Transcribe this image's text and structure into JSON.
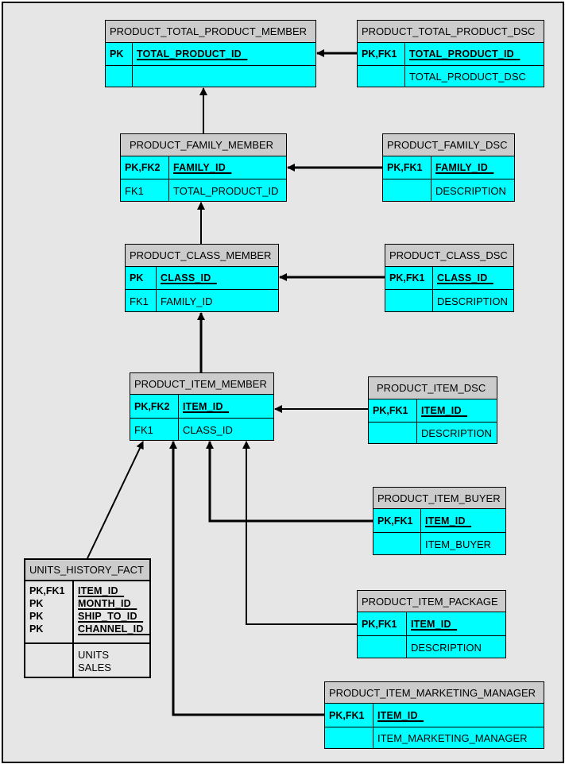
{
  "diagram": {
    "type": "entity-relationship",
    "colors": {
      "background": "#e6e6e6",
      "table_header": "#cccccc",
      "table_body": "#00ffff",
      "fact_body": "#e6e6e6",
      "lines": "#000000"
    }
  },
  "tables": {
    "total_product_member": {
      "name": "PRODUCT_TOTAL_PRODUCT_MEMBER",
      "key_rows": [
        {
          "key": "PK",
          "column": "TOTAL_PRODUCT_ID"
        }
      ],
      "attr_rows": [
        {
          "key": "",
          "column": ""
        }
      ]
    },
    "total_product_dsc": {
      "name": "PRODUCT_TOTAL_PRODUCT_DSC",
      "key_rows": [
        {
          "key": "PK,FK1",
          "column": "TOTAL_PRODUCT_ID"
        }
      ],
      "attr_rows": [
        {
          "key": "",
          "column": "TOTAL_PRODUCT_DSC"
        }
      ]
    },
    "family_member": {
      "name": "PRODUCT_FAMILY_MEMBER",
      "key_rows": [
        {
          "key": "PK,FK2",
          "column": "FAMILY_ID"
        }
      ],
      "attr_rows": [
        {
          "key": "FK1",
          "column": "TOTAL_PRODUCT_ID"
        }
      ]
    },
    "family_dsc": {
      "name": "PRODUCT_FAMILY_DSC",
      "key_rows": [
        {
          "key": "PK,FK1",
          "column": "FAMILY_ID"
        }
      ],
      "attr_rows": [
        {
          "key": "",
          "column": "DESCRIPTION"
        }
      ]
    },
    "class_member": {
      "name": "PRODUCT_CLASS_MEMBER",
      "key_rows": [
        {
          "key": "PK",
          "column": "CLASS_ID"
        }
      ],
      "attr_rows": [
        {
          "key": "FK1",
          "column": "FAMILY_ID"
        }
      ]
    },
    "class_dsc": {
      "name": "PRODUCT_CLASS_DSC",
      "key_rows": [
        {
          "key": "PK,FK1",
          "column": "CLASS_ID"
        }
      ],
      "attr_rows": [
        {
          "key": "",
          "column": "DESCRIPTION"
        }
      ]
    },
    "item_member": {
      "name": "PRODUCT_ITEM_MEMBER",
      "key_rows": [
        {
          "key": "PK,FK2",
          "column": "ITEM_ID"
        }
      ],
      "attr_rows": [
        {
          "key": "FK1",
          "column": "CLASS_ID"
        }
      ]
    },
    "item_dsc": {
      "name": "PRODUCT_ITEM_DSC",
      "key_rows": [
        {
          "key": "PK,FK1",
          "column": "ITEM_ID"
        }
      ],
      "attr_rows": [
        {
          "key": "",
          "column": "DESCRIPTION"
        }
      ]
    },
    "item_buyer": {
      "name": "PRODUCT_ITEM_BUYER",
      "key_rows": [
        {
          "key": "PK,FK1",
          "column": "ITEM_ID"
        }
      ],
      "attr_rows": [
        {
          "key": "",
          "column": "ITEM_BUYER"
        }
      ]
    },
    "item_package": {
      "name": "PRODUCT_ITEM_PACKAGE",
      "key_rows": [
        {
          "key": "PK,FK1",
          "column": "ITEM_ID"
        }
      ],
      "attr_rows": [
        {
          "key": "",
          "column": "DESCRIPTION"
        }
      ]
    },
    "units_history_fact": {
      "name": "UNITS_HISTORY_FACT",
      "key_rows": [
        {
          "key": "PK,FK1",
          "column": "ITEM_ID"
        },
        {
          "key": "PK",
          "column": "MONTH_ID"
        },
        {
          "key": "PK",
          "column": "SHIP_TO_ID"
        },
        {
          "key": "PK",
          "column": "CHANNEL_ID"
        }
      ],
      "attr_rows": [
        {
          "key": "",
          "column": "UNITS"
        },
        {
          "key": "",
          "column": "SALES"
        }
      ]
    },
    "item_marketing_manager": {
      "name": "PRODUCT_ITEM_MARKETING_MANAGER",
      "key_rows": [
        {
          "key": "PK,FK1",
          "column": "ITEM_ID"
        }
      ],
      "attr_rows": [
        {
          "key": "",
          "column": "ITEM_MARKETING_MANAGER"
        }
      ]
    }
  },
  "relationships": [
    {
      "from": "PRODUCT_TOTAL_PRODUCT_DSC",
      "to": "PRODUCT_TOTAL_PRODUCT_MEMBER"
    },
    {
      "from": "PRODUCT_FAMILY_MEMBER",
      "to": "PRODUCT_TOTAL_PRODUCT_MEMBER"
    },
    {
      "from": "PRODUCT_FAMILY_DSC",
      "to": "PRODUCT_FAMILY_MEMBER"
    },
    {
      "from": "PRODUCT_CLASS_MEMBER",
      "to": "PRODUCT_FAMILY_MEMBER"
    },
    {
      "from": "PRODUCT_CLASS_DSC",
      "to": "PRODUCT_CLASS_MEMBER"
    },
    {
      "from": "PRODUCT_ITEM_MEMBER",
      "to": "PRODUCT_CLASS_MEMBER"
    },
    {
      "from": "PRODUCT_ITEM_DSC",
      "to": "PRODUCT_ITEM_MEMBER"
    },
    {
      "from": "UNITS_HISTORY_FACT",
      "to": "PRODUCT_ITEM_MEMBER"
    },
    {
      "from": "PRODUCT_ITEM_MARKETING_MANAGER",
      "to": "PRODUCT_ITEM_MEMBER"
    },
    {
      "from": "PRODUCT_ITEM_BUYER",
      "to": "PRODUCT_ITEM_MEMBER"
    },
    {
      "from": "PRODUCT_ITEM_PACKAGE",
      "to": "PRODUCT_ITEM_MEMBER"
    }
  ]
}
